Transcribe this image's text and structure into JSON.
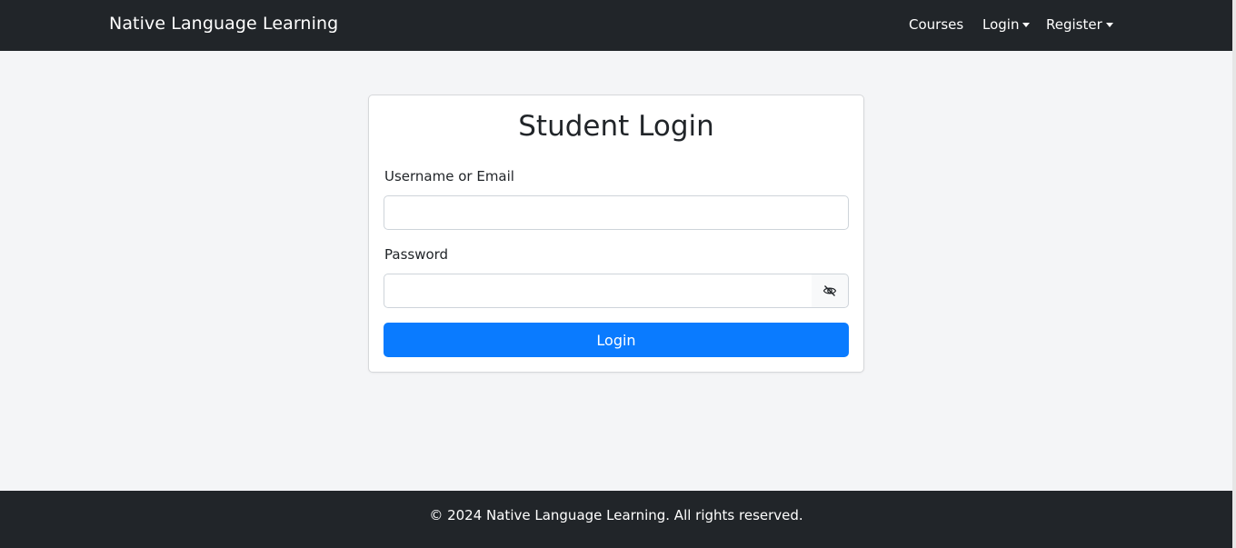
{
  "navbar": {
    "brand": "Native Language Learning",
    "links": [
      {
        "label": "Courses",
        "dropdown": false
      },
      {
        "label": "Login",
        "dropdown": true
      },
      {
        "label": "Register",
        "dropdown": true
      }
    ]
  },
  "login_card": {
    "title": "Student Login",
    "username_label": "Username or Email",
    "username_value": "",
    "password_label": "Password",
    "password_value": "",
    "toggle_icon": "eye-slash-icon",
    "submit_label": "Login"
  },
  "footer": {
    "text": "© 2024 Native Language Learning. All rights reserved."
  },
  "colors": {
    "navbar_bg": "#212529",
    "page_bg": "#f4f5f7",
    "primary": "#0a7bff"
  }
}
